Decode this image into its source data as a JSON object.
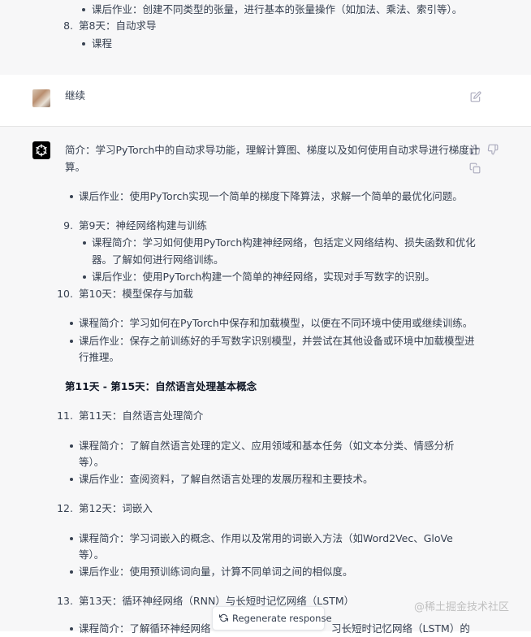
{
  "prev_message": {
    "line1": "课后作业：创建不同类型的张量，进行基本的张量操作（如加法、乘法、索引等）。",
    "item8_num": "8.",
    "item8_text": "第8天：自动求导",
    "item8_sub": "课程"
  },
  "user_message": {
    "text": "继续"
  },
  "assistant_message": {
    "intro_line1": "简介：学习PyTorch中的自动求导功能，理解计算图、梯度以及如何使用自动求导进行梯度计",
    "intro_line2": "算。",
    "homework8": "课后作业：使用PyTorch实现一个简单的梯度下降算法，求解一个简单的最优化问题。",
    "item9_num": "9.",
    "item9": "第9天：神经网络构建与训练",
    "item9_intro_l1": "课程简介：学习如何使用PyTorch构建神经网络，包括定义网络结构、损失函数和优化",
    "item9_intro_l2": "器。了解如何进行网络训练。",
    "item9_hw": "课后作业：使用PyTorch构建一个简单的神经网络，实现对手写数字的识别。",
    "item10_num": "10.",
    "item10": "第10天：模型保存与加载",
    "item10_intro": "课程简介：学习如何在PyTorch中保存和加载模型，以便在不同环境中使用或继续训练。",
    "item10_hw_l1": "课后作业：保存之前训练好的手写数字识别模型，并尝试在其他设备或环境中加载模型进",
    "item10_hw_l2": "行推理。",
    "section_heading": "第11天 - 第15天：自然语言处理基本概念",
    "item11_num": "11.",
    "item11": "第11天：自然语言处理简介",
    "item11_intro_l1": "课程简介：了解自然语言处理的定义、应用领域和基本任务（如文本分类、情感分析",
    "item11_intro_l2": "等）。",
    "item11_hw": "课后作业：查阅资料，了解自然语言处理的发展历程和主要技术。",
    "item12_num": "12.",
    "item12": "第12天：词嵌入",
    "item12_intro_l1": "课程简介：学习词嵌入的概念、作用以及常用的词嵌入方法（如Word2Vec、GloVe",
    "item12_intro_l2": "等）。",
    "item12_hw": "课后作业：使用预训练词向量，计算不同单词之间的相似度。",
    "item13_num": "13.",
    "item13": "第13天：循环神经网络（RNN）与长短时记忆网络（LSTM）",
    "item13_intro_partial": "课程简介：了解循环神经网络",
    "item13_intro_partial_tail": "习长短时记忆网络（LSTM）的"
  },
  "controls": {
    "regenerate_label": "Regenerate response"
  },
  "watermark": "@稀土掘金技术社区",
  "icons": [
    "edit-icon",
    "thumbs-up-icon",
    "thumbs-down-icon",
    "copy-icon",
    "refresh-icon",
    "openai-logo-icon"
  ],
  "colors": {
    "text": "#374151",
    "assistant_bg": "#f7f7f8",
    "user_bg": "#ffffff",
    "icon": "#acacbe"
  }
}
